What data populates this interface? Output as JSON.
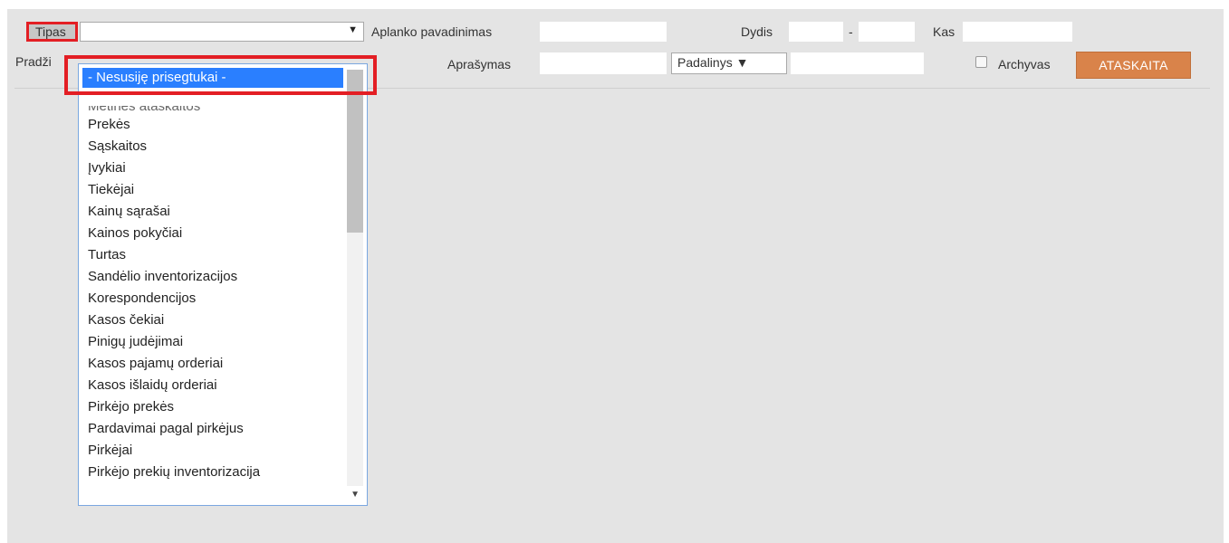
{
  "filters": {
    "tipas_label": "Tipas",
    "aplanko_label": "Aplanko pavadinimas",
    "dydis_label": "Dydis",
    "dydis_dash": "-",
    "kas_label": "Kas",
    "pradzia_label": "Pradži",
    "aprasymas_label": "Aprašymas",
    "padalinys_value": "Padalinys ▼",
    "archyvas_label": "Archyvas",
    "report_button": "ATASKAITA"
  },
  "dropdown": {
    "selected": "- Nesusiję prisegtukai -",
    "items": [
      "Metinės ataskaitos",
      "Prekės",
      "Sąskaitos",
      "Įvykiai",
      "Tiekėjai",
      "Kainų sąrašai",
      "Kainos pokyčiai",
      "Turtas",
      "Sandėlio inventorizacijos",
      "Korespondencijos",
      "Kasos čekiai",
      "Pinigų judėjimai",
      "Kasos pajamų orderiai",
      "Kasos išlaidų orderiai",
      "Pirkėjo prekės",
      "Pardavimai pagal pirkėjus",
      "Pirkėjai",
      "Pirkėjo prekių inventorizacija"
    ]
  },
  "icons": {
    "select_arrow": "▼",
    "scroll_down": "▼"
  },
  "colors": {
    "highlight": "#e31e24",
    "selected_item": "#2a7fff",
    "report_button": "#d9834a",
    "panel_background": "#e4e4e4"
  }
}
